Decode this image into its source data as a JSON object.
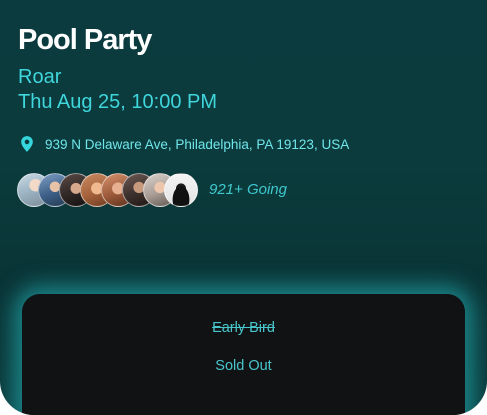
{
  "event": {
    "title": "Pool Party",
    "host": "Roar",
    "datetime": "Thu Aug 25, 10:00 PM",
    "address": "939 N Delaware Ave, Philadelphia, PA 19123, USA"
  },
  "attendees": {
    "going_label": "921+ Going",
    "avatar_count": 8
  },
  "ticket": {
    "tier_name": "Early Bird",
    "status": "Sold Out"
  },
  "colors": {
    "accent": "#3fd6dc",
    "background": "#0b3b3e",
    "ticket_bg": "#111214"
  },
  "icons": {
    "location": "map-pin-icon"
  }
}
